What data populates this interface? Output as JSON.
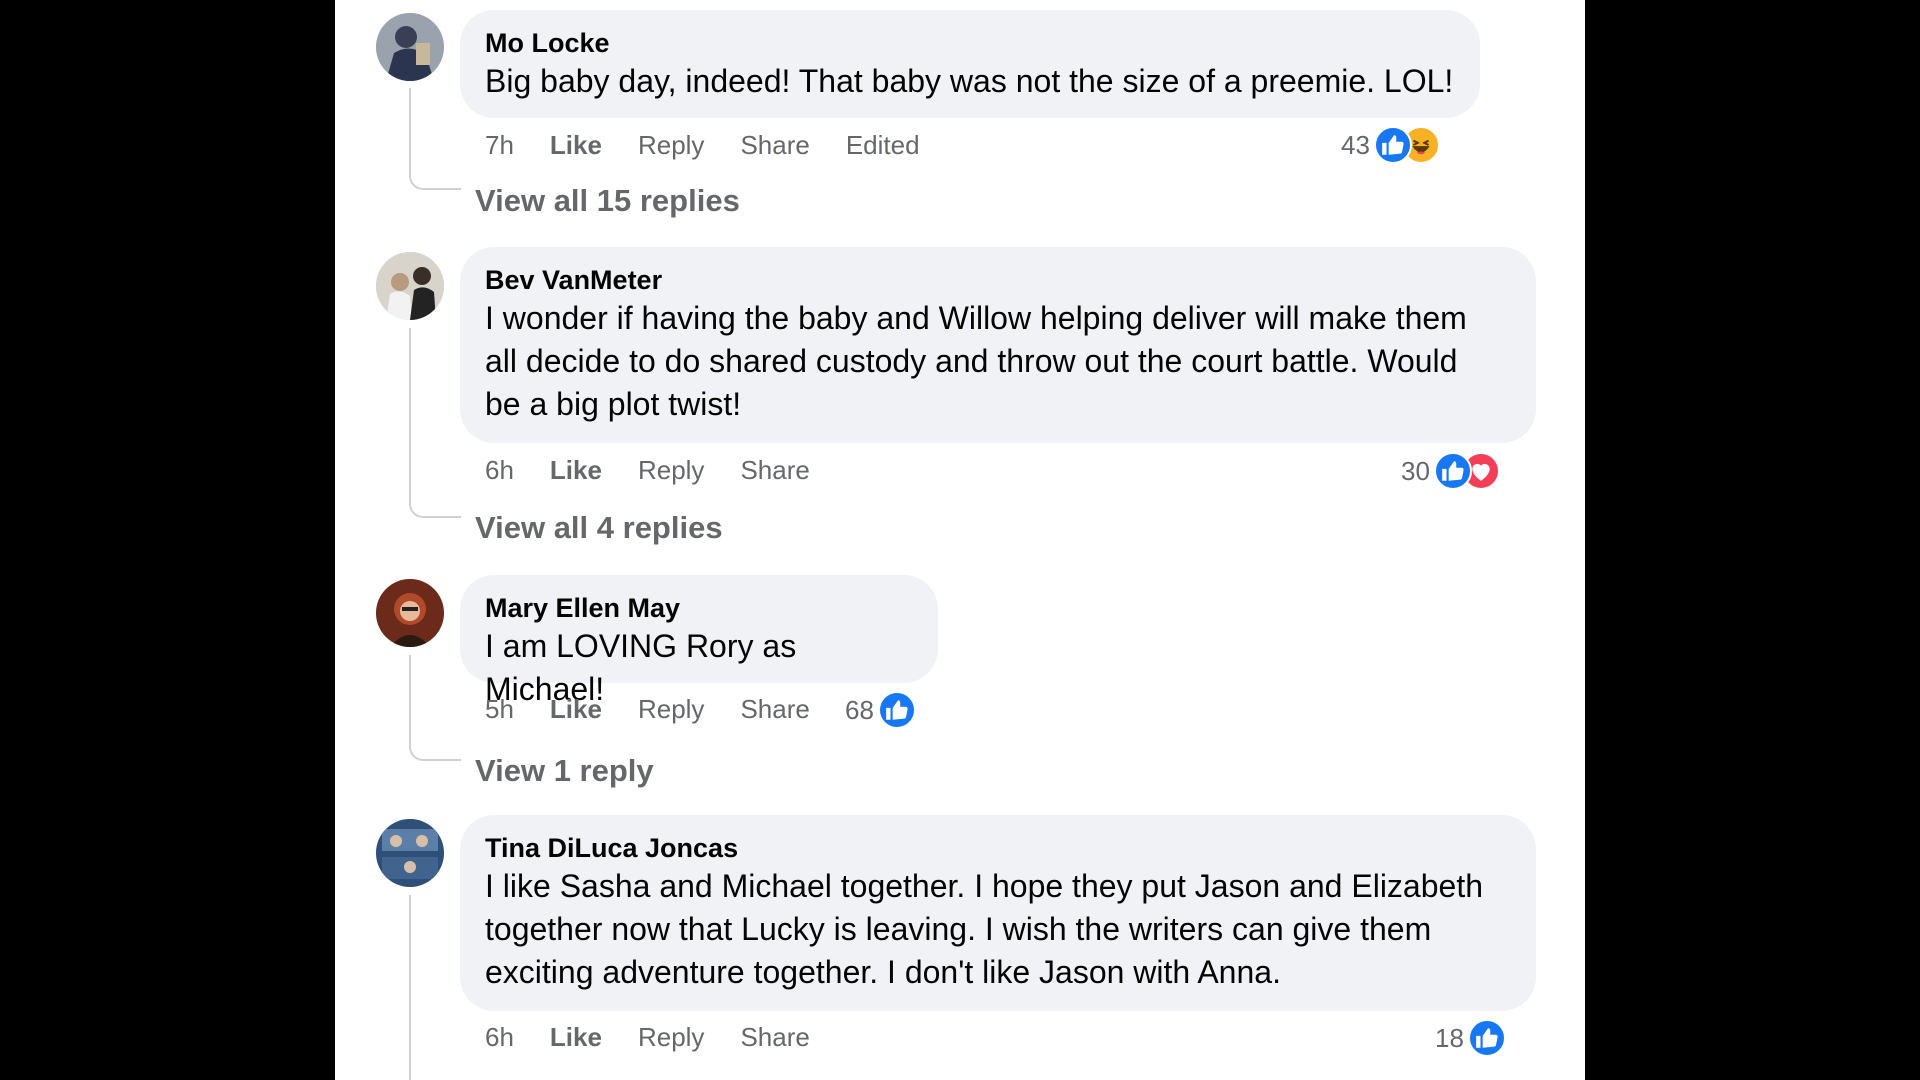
{
  "comments": [
    {
      "author": "Mo Locke",
      "text": "Big baby day, indeed! That baby was not the size of a preemie. LOL!",
      "time": "7h",
      "like": "Like",
      "reply": "Reply",
      "share": "Share",
      "edited": "Edited",
      "reaction_count": "43",
      "reactions": [
        "like-icon",
        "haha-icon"
      ],
      "view_replies": "View all 15 replies"
    },
    {
      "author": "Bev VanMeter",
      "text_lines": [
        "I wonder if having the baby and Willow helping deliver will make them",
        "all decide to do shared custody and throw out the court battle. Would",
        "be a big plot twist!"
      ],
      "time": "6h",
      "like": "Like",
      "reply": "Reply",
      "share": "Share",
      "reaction_count": "30",
      "reactions": [
        "like-icon",
        "love-icon"
      ],
      "view_replies": "View all 4 replies"
    },
    {
      "author": "Mary Ellen May",
      "text": "I am LOVING Rory as Michael!",
      "time": "5h",
      "like": "Like",
      "reply": "Reply",
      "share": "Share",
      "reaction_count": "68",
      "reactions": [
        "like-icon"
      ],
      "view_replies": "View 1 reply"
    },
    {
      "author": "Tina DiLuca Joncas",
      "text_lines": [
        "I like Sasha and Michael together. I hope they put Jason and Elizabeth",
        "together now that Lucky is leaving. I wish the writers can give them",
        "exciting adventure together. I don't like Jason with Anna."
      ],
      "time": "6h",
      "like": "Like",
      "reply": "Reply",
      "share": "Share",
      "reaction_count": "18",
      "reactions": [
        "like-icon"
      ]
    }
  ],
  "colors": {
    "bubble": "#f0f2f5",
    "secondary_text": "#65676b",
    "like_blue": "#1877f2",
    "love_red": "#f33e58",
    "haha_yellow": "#f7b125"
  }
}
